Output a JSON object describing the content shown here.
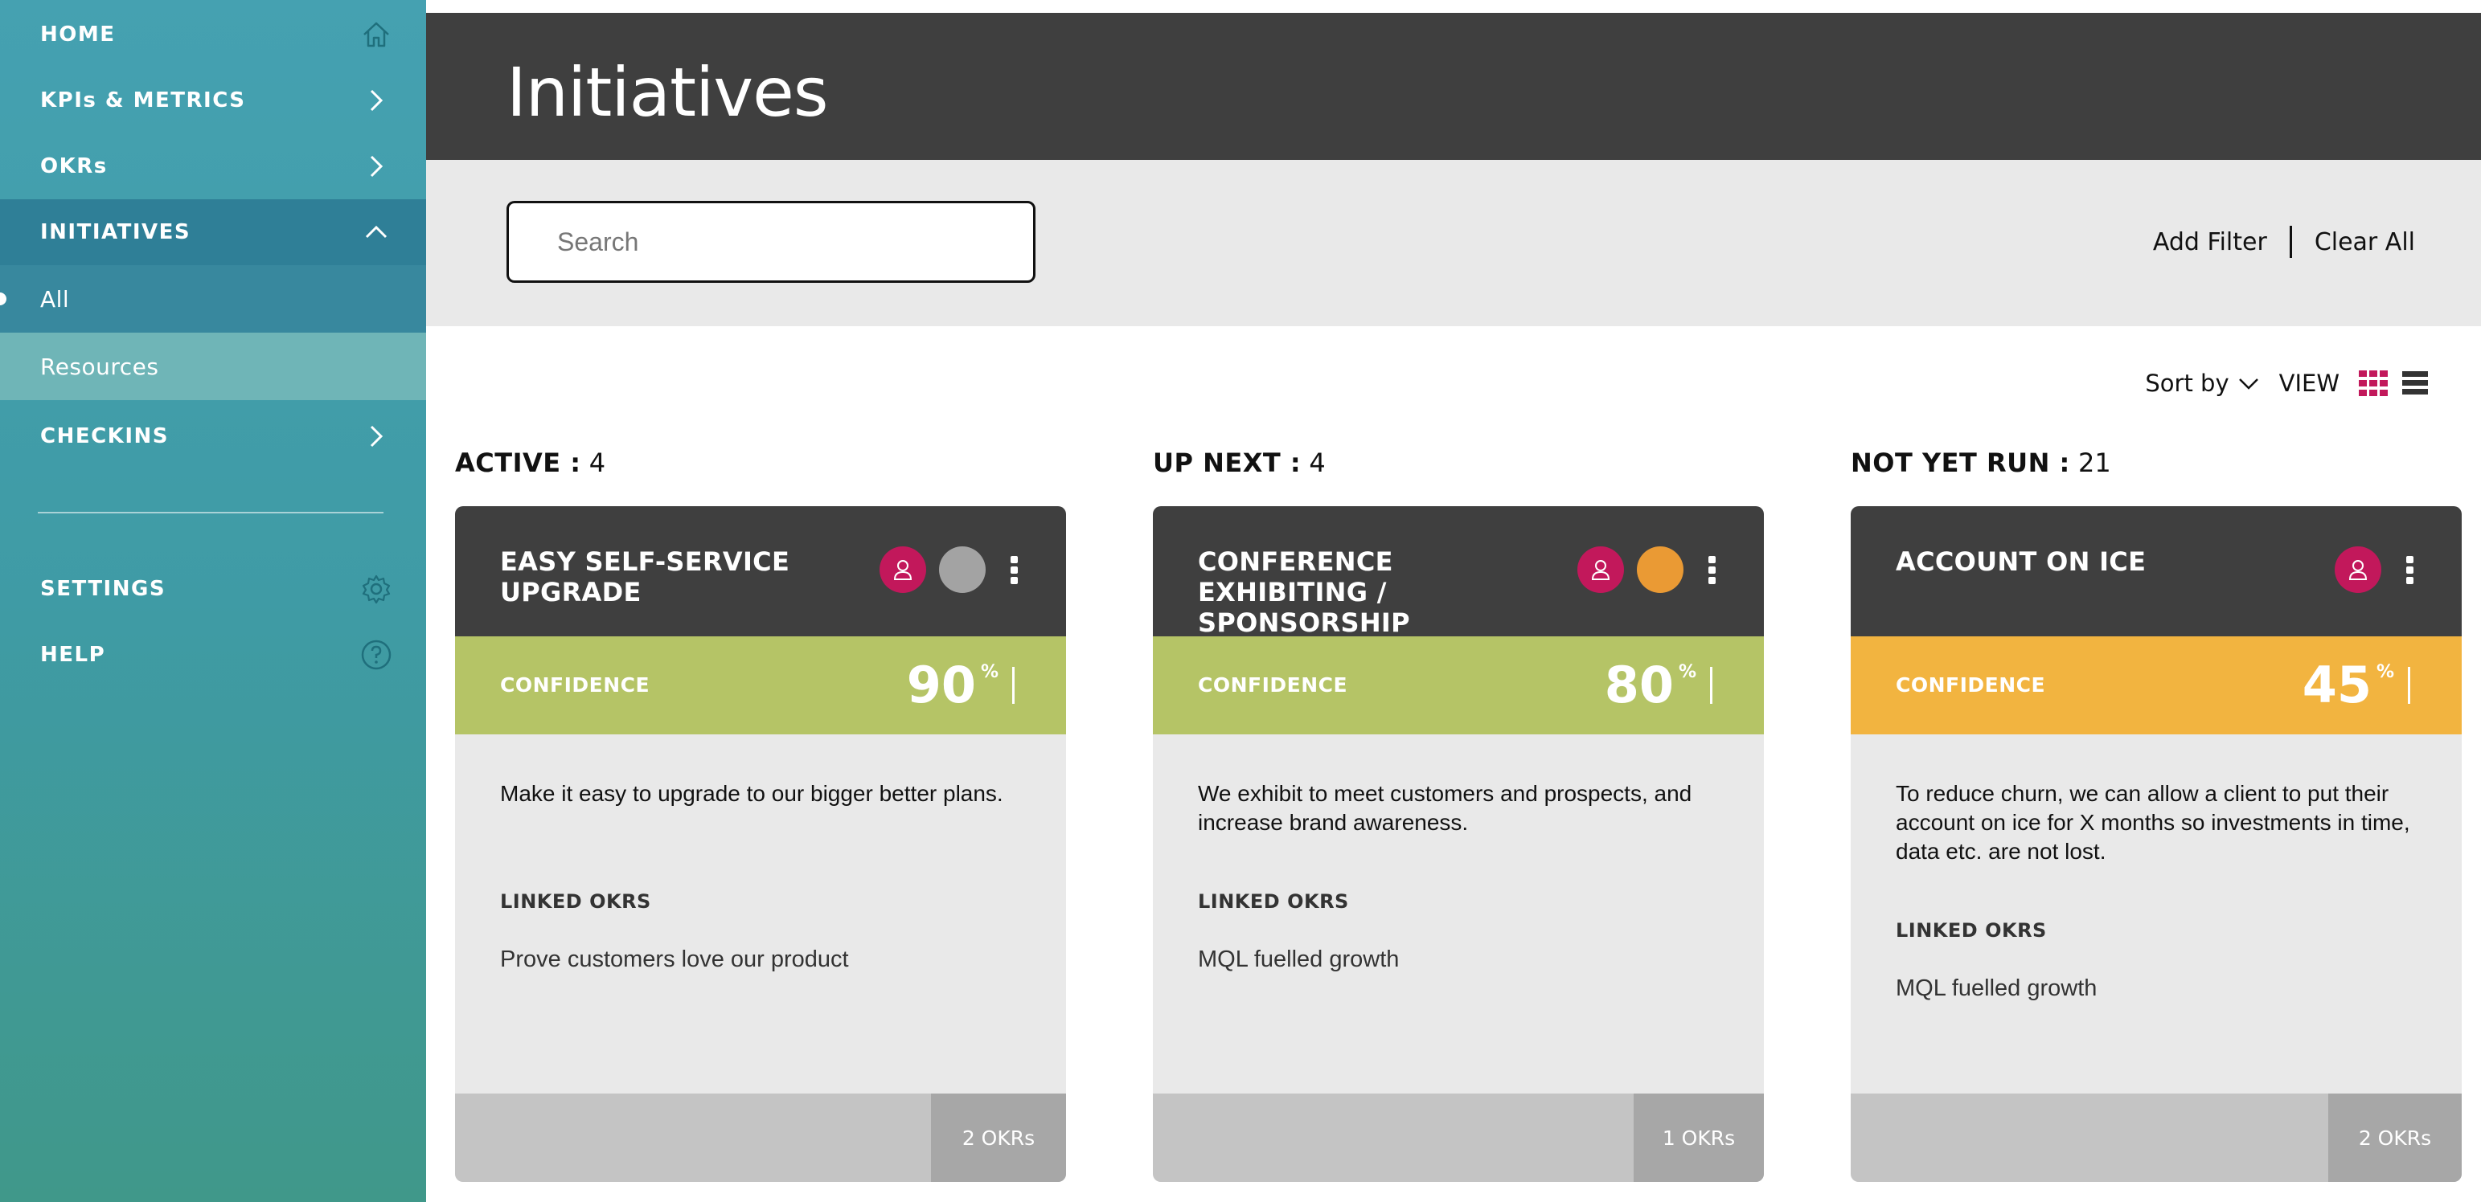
{
  "colors": {
    "sidebar_top": "#45a1b1",
    "sidebar_active": "#2f7f97",
    "header_dark": "#3f3f3f",
    "confidence_green": "#b5c466",
    "confidence_orange": "#f2b440",
    "avatar_red": "#c2185b",
    "grid_view_accent": "#c2185b"
  },
  "sidebar": {
    "items": [
      {
        "label": "HOME",
        "icon": "home-icon"
      },
      {
        "label": "KPIs & METRICS",
        "icon": "chevron-right-icon"
      },
      {
        "label": "OKRs",
        "icon": "chevron-right-icon"
      },
      {
        "label": "INITIATIVES",
        "icon": "chevron-up-icon"
      },
      {
        "label": "CHECKINS",
        "icon": "chevron-right-icon"
      },
      {
        "label": "SETTINGS",
        "icon": "gear-icon"
      },
      {
        "label": "HELP",
        "icon": "help-icon"
      }
    ],
    "sub_items": [
      {
        "label": "All"
      },
      {
        "label": "Resources"
      }
    ]
  },
  "header": {
    "title": "Initiatives"
  },
  "filters": {
    "search_placeholder": "Search",
    "add_filter": "Add Filter",
    "clear_all": "Clear All"
  },
  "sort": {
    "label": "Sort by",
    "view_label": "VIEW"
  },
  "columns": [
    {
      "label": "ACTIVE :",
      "count": "4"
    },
    {
      "label": "UP NEXT :",
      "count": "4"
    },
    {
      "label": "NOT YET RUN :",
      "count": "21"
    }
  ],
  "cards": [
    {
      "title": "EASY SELF-SERVICE UPGRADE",
      "status_color": "#a3a3a3",
      "confidence_label": "CONFIDENCE",
      "confidence": "90",
      "percent_sign": "%",
      "band_color": "#b5c466",
      "description": "Make it easy to upgrade to our bigger better plans.",
      "linked_label": "LINKED OKRS",
      "linked_okr": "Prove customers love our product",
      "okr_count": "2 OKRs"
    },
    {
      "title": "CONFERENCE EXHIBITING / SPONSORSHIP",
      "status_color": "#ea9a34",
      "confidence_label": "CONFIDENCE",
      "confidence": "80",
      "percent_sign": "%",
      "band_color": "#b5c466",
      "description": "We exhibit to meet customers and prospects, and increase brand awareness.",
      "linked_label": "LINKED OKRS",
      "linked_okr": "MQL fuelled growth",
      "okr_count": "1 OKRs"
    },
    {
      "title": "ACCOUNT ON ICE",
      "status_color": "",
      "confidence_label": "CONFIDENCE",
      "confidence": "45",
      "percent_sign": "%",
      "band_color": "#f2b440",
      "description": "To reduce churn, we can allow a client to put their account on ice for X months so investments in time, data etc. are not lost.",
      "linked_label": "LINKED OKRS",
      "linked_okr": "MQL fuelled growth",
      "okr_count": "2 OKRs"
    }
  ]
}
